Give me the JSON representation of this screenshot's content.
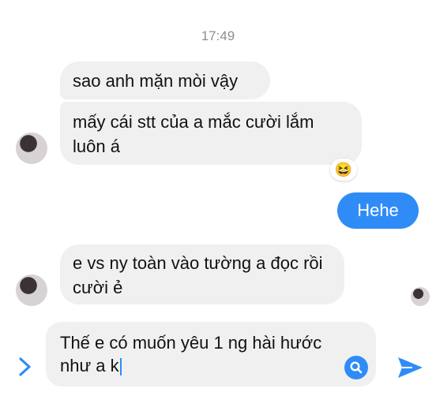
{
  "thread": {
    "timestamp": "17:49",
    "messages": [
      {
        "direction": "incoming",
        "text": "sao anh mặn mòi vậy"
      },
      {
        "direction": "incoming",
        "text": "mấy cái stt của a mắc cười lắm luôn á",
        "reaction": "😆"
      },
      {
        "direction": "outgoing",
        "text": "Hehe"
      },
      {
        "direction": "incoming",
        "text": "e vs ny toàn vào tường a đọc rồi cười ẻ"
      }
    ]
  },
  "composer": {
    "text": "Thế e có muốn yêu 1 ng hài hước như a k",
    "expand_icon": "chevron-right-icon",
    "search_icon": "search-icon",
    "send_icon": "send-icon"
  },
  "colors": {
    "accent": "#2f8cf7",
    "incoming_bubble": "#f0f0f0",
    "timestamp": "#8e8e93"
  }
}
